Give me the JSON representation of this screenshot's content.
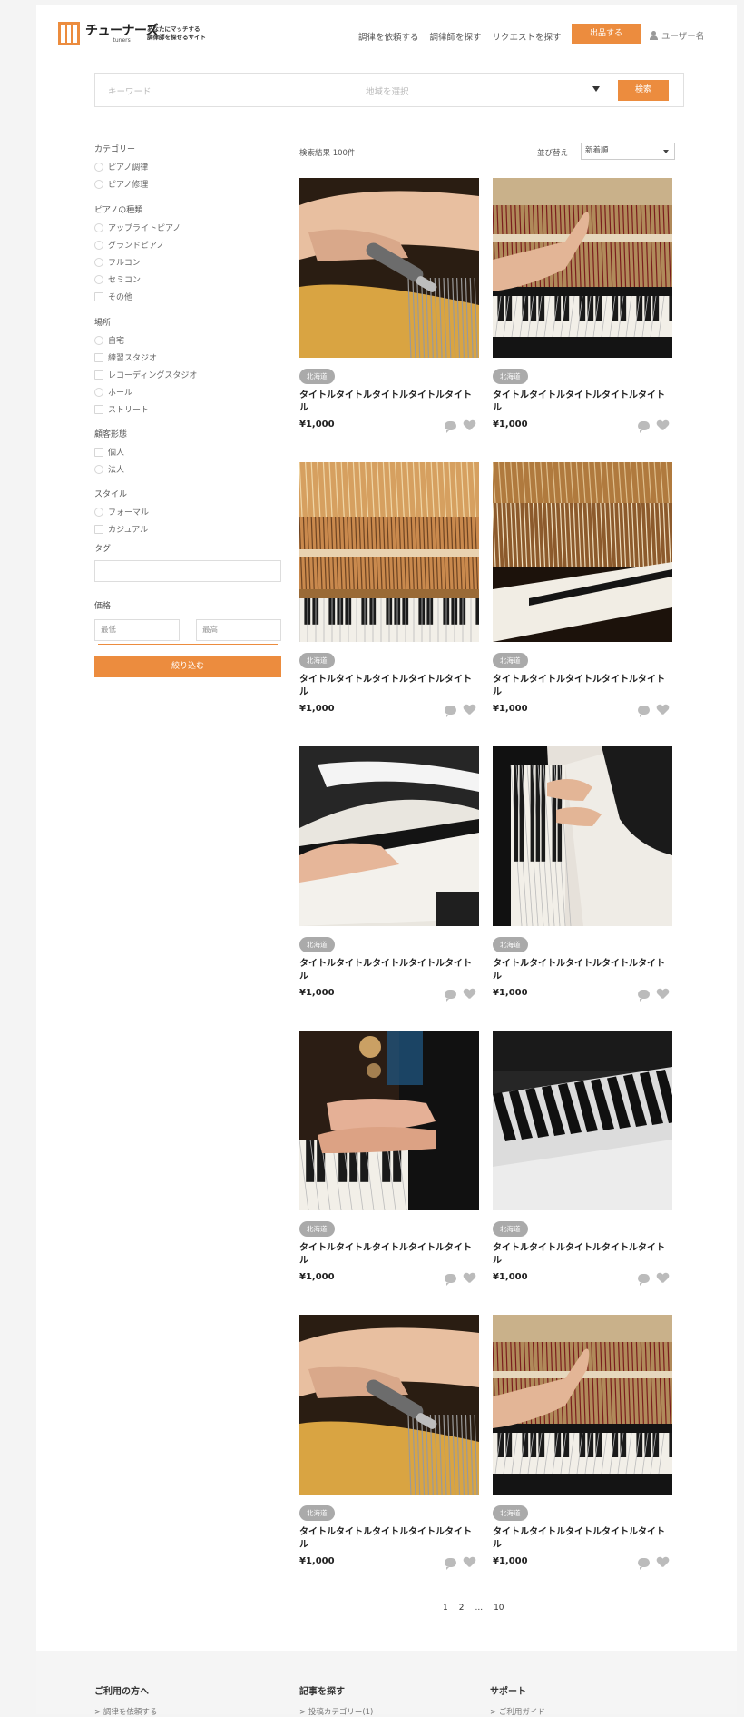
{
  "header": {
    "logo_name": "チューナーズ",
    "logo_sub": "tuners",
    "tagline_1": "あなたにマッチする",
    "tagline_2": "調律師を探せるサイト",
    "nav": [
      "調律を依頼する",
      "調律師を探す",
      "リクエストを探す"
    ],
    "post_button": "出品する",
    "user_name": "ユーザー名"
  },
  "search": {
    "keyword_placeholder": "キーワード",
    "region_placeholder": "地域を選択",
    "button": "検索"
  },
  "filters": {
    "category": {
      "title": "カテゴリー",
      "options": [
        "ピアノ調律",
        "ピアノ修理"
      ]
    },
    "piano_type": {
      "title": "ピアノの種類",
      "options": [
        "アップライトピアノ",
        "グランドピアノ",
        "フルコン",
        "セミコン",
        "その他"
      ]
    },
    "location": {
      "title": "場所",
      "options": [
        "自宅",
        "練習スタジオ",
        "レコーディングスタジオ",
        "ホール",
        "ストリート"
      ]
    },
    "customer": {
      "title": "顧客形態",
      "options": [
        "個人",
        "法人"
      ]
    },
    "style": {
      "title": "スタイル",
      "options": [
        "フォーマル",
        "カジュアル"
      ]
    },
    "tag_title": "タグ",
    "price_title": "価格",
    "price_min": "最低",
    "price_max": "最高",
    "submit": "絞り込む"
  },
  "results": {
    "count_label": "検索結果 100件",
    "sort_label": "並び替え",
    "sort_value": "新着順"
  },
  "cards": [
    {
      "badge": "北海道",
      "title": "タイトルタイトルタイトルタイトルタイトル",
      "price": "¥1,000",
      "image": "tuning-hammer"
    },
    {
      "badge": "北海道",
      "title": "タイトルタイトルタイトルタイトルタイトル",
      "price": "¥1,000",
      "image": "upright-interior"
    },
    {
      "badge": "北海道",
      "title": "タイトルタイトルタイトルタイトルタイトル",
      "price": "¥1,000",
      "image": "grand-action"
    },
    {
      "badge": "北海道",
      "title": "タイトルタイトルタイトルタイトルタイトル",
      "price": "¥1,000",
      "image": "upright-action"
    },
    {
      "badge": "北海道",
      "title": "タイトルタイトルタイトルタイトルタイトル",
      "price": "¥1,000",
      "image": "grand-keys"
    },
    {
      "badge": "北海道",
      "title": "タイトルタイトルタイトルタイトルタイトル",
      "price": "¥1,000",
      "image": "digital-piano"
    },
    {
      "badge": "北海道",
      "title": "タイトルタイトルタイトルタイトルタイトル",
      "price": "¥1,000",
      "image": "hands-playing"
    },
    {
      "badge": "北海道",
      "title": "タイトルタイトルタイトルタイトルタイトル",
      "price": "¥1,000",
      "image": "keyboard-closeup"
    },
    {
      "badge": "北海道",
      "title": "タイトルタイトルタイトルタイトルタイトル",
      "price": "¥1,000",
      "image": "tuning-hammer"
    },
    {
      "badge": "北海道",
      "title": "タイトルタイトルタイトルタイトルタイトル",
      "price": "¥1,000",
      "image": "upright-interior"
    }
  ],
  "pagination": [
    "1",
    "2",
    "...",
    "10"
  ],
  "footer": {
    "columns": [
      {
        "title": "ご利用の方へ",
        "link": "> 調律を依頼する"
      },
      {
        "title": "記事を探す",
        "link": "> 投稿カテゴリー(1)"
      },
      {
        "title": "サポート",
        "link": "> ご利用ガイド"
      }
    ]
  },
  "colors": {
    "accent": "#ec8c3e",
    "badge": "#aaaaaa"
  }
}
